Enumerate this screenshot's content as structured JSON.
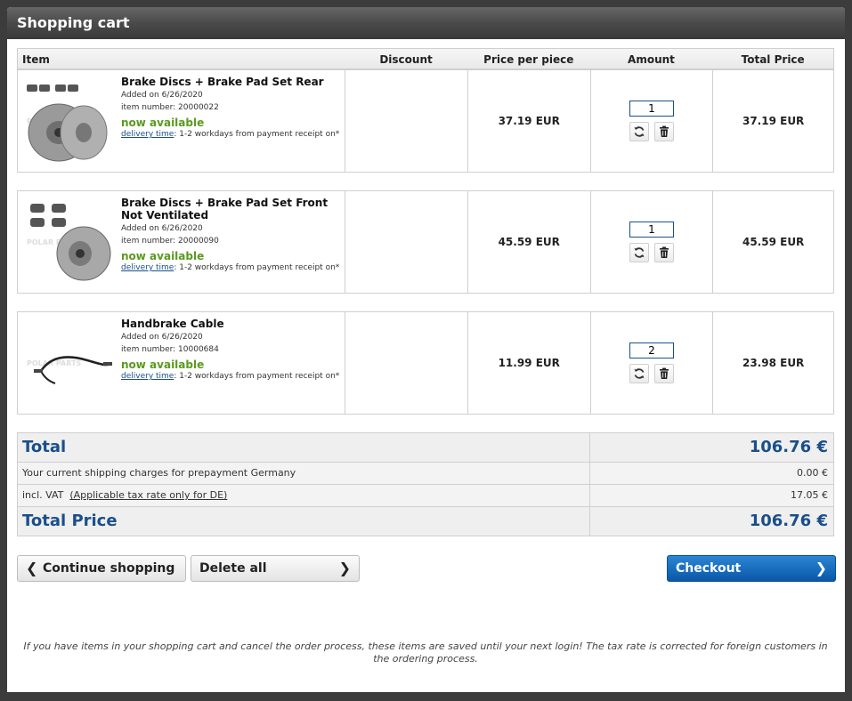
{
  "title": "Shopping cart",
  "columns": {
    "item": "Item",
    "discount": "Discount",
    "price_per_piece": "Price per piece",
    "amount": "Amount",
    "total_price": "Total Price"
  },
  "items": [
    {
      "name": "Brake Discs + Brake Pad Set Rear",
      "added": "Added on  6/26/2020",
      "item_number": "item number: 20000022",
      "availability": "now available",
      "delivery_link": "delivery time",
      "delivery_text": ": 1-2 workdays from payment receipt on*",
      "price": "37.19 EUR",
      "qty": "1",
      "total": "37.19 EUR"
    },
    {
      "name": "Brake Discs + Brake Pad Set Front Not Ventilated",
      "added": "Added on  6/26/2020",
      "item_number": "item number: 20000090",
      "availability": "now available",
      "delivery_link": "delivery time",
      "delivery_text": ": 1-2 workdays from payment receipt on*",
      "price": "45.59 EUR",
      "qty": "1",
      "total": "45.59 EUR"
    },
    {
      "name": "Handbrake Cable",
      "added": "Added on  6/26/2020",
      "item_number": "item number: 10000684",
      "availability": "now available",
      "delivery_link": "delivery time",
      "delivery_text": ": 1-2 workdays from payment receipt on*",
      "price": "11.99 EUR",
      "qty": "2",
      "total": "23.98 EUR"
    }
  ],
  "totals": {
    "total_label": "Total",
    "total_value": "106.76 €",
    "shipping_label": "Your current shipping charges for prepayment Germany",
    "shipping_value": "0.00 €",
    "vat_prefix": "incl. VAT",
    "vat_link": "(Applicable tax rate only for DE)",
    "vat_value": "17.05 €",
    "total_price_label": "Total Price",
    "total_price_value": "106.76 €"
  },
  "buttons": {
    "continue": "Continue shopping",
    "delete_all": "Delete all",
    "checkout": "Checkout"
  },
  "icons": {
    "refresh": "refresh-icon",
    "trash": "trash-icon",
    "chevron_left": "chevron-left-icon",
    "chevron_right": "chevron-right-icon"
  },
  "footer_note": "If you have items in your shopping cart and cancel the order process, these items are saved until your next login! The tax rate is corrected for foreign customers in the ordering process."
}
